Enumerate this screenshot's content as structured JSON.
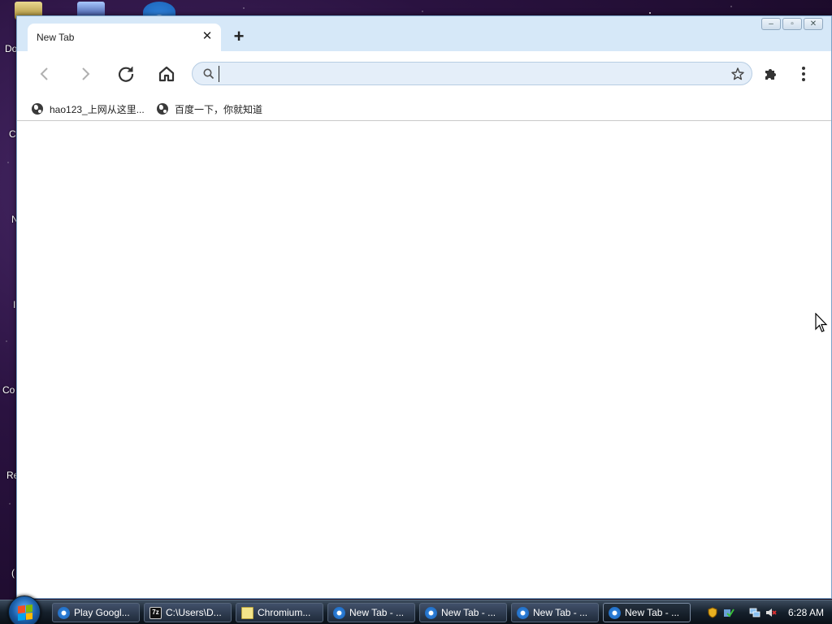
{
  "browser": {
    "tab": {
      "title": "New Tab",
      "close_glyph": "✕"
    },
    "new_tab_glyph": "+",
    "window_controls": {
      "minimize": "–",
      "maximize": "▫",
      "close": "✕"
    },
    "toolbar": {
      "back_icon": "back-arrow-icon",
      "forward_icon": "forward-arrow-icon",
      "reload_icon": "reload-icon",
      "home_icon": "home-icon",
      "omnibox": {
        "value": "",
        "placeholder": ""
      },
      "bookmark_star_icon": "star-icon",
      "extensions_icon": "puzzle-icon",
      "menu_icon": "kebab-menu-icon"
    },
    "bookmarks": [
      {
        "label": "hao123_上网从这里..."
      },
      {
        "label": "百度一下，你就知道"
      }
    ]
  },
  "taskbar": {
    "items": [
      {
        "label": "Play Googl...",
        "icon": "chromium-icon",
        "active": false
      },
      {
        "label": "C:\\Users\\D...",
        "icon": "7zip-icon",
        "active": false
      },
      {
        "label": "Chromium...",
        "icon": "file-icon",
        "active": false
      },
      {
        "label": "New Tab - ...",
        "icon": "chromium-icon",
        "active": false
      },
      {
        "label": "New Tab - ...",
        "icon": "chromium-icon",
        "active": false
      },
      {
        "label": "New Tab - ...",
        "icon": "chromium-icon",
        "active": false
      },
      {
        "label": "New Tab - ...",
        "icon": "chromium-icon",
        "active": true
      }
    ],
    "clock": "6:28 AM",
    "zip_icon_text": "7z"
  },
  "desktop": {
    "icon_stubs": [
      "Do",
      "C",
      "N",
      "I",
      "Co",
      "Re",
      "("
    ]
  },
  "colors": {
    "titlebar": "#d6e8f8",
    "omnibox_bg": "#e4eef9",
    "taskbar": "#15202c"
  }
}
